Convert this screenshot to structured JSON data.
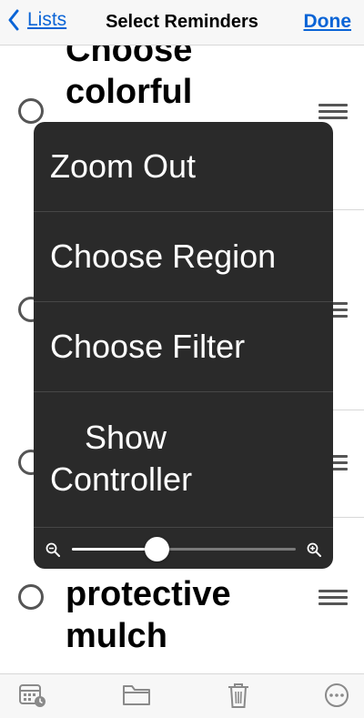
{
  "nav": {
    "back_label": "Lists",
    "title": "Select Reminders",
    "done_label": "Done"
  },
  "list": {
    "items": [
      {
        "lines": [
          "Choose",
          "colorful"
        ]
      },
      {
        "lines": [
          "protective",
          "mulch"
        ]
      }
    ]
  },
  "zoom_menu": {
    "items": [
      {
        "label": "Zoom Out"
      },
      {
        "label": "Choose Region"
      },
      {
        "label": "Choose Filter"
      },
      {
        "lines": [
          "Show",
          "Controller"
        ]
      }
    ],
    "slider": {
      "level": 0.38
    }
  },
  "toolbar": {
    "icons": [
      "calendar-clock-icon",
      "folder-icon",
      "trash-icon",
      "more-icon"
    ]
  },
  "colors": {
    "accent": "#0a64d6",
    "menu_bg": "#2a2a2a"
  }
}
